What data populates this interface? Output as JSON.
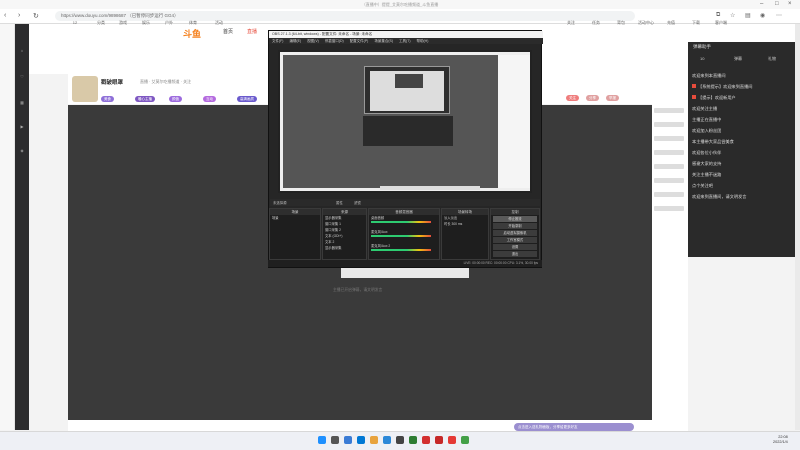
{
  "window": {
    "title": "（直播中）提提_艾莫尔吃播频道_斗鱼直播"
  },
  "browser": {
    "url": "https://www.douyu.com/9898687 （已暂停同步运行 GG4）"
  },
  "site": {
    "brand": "斗鱼",
    "nav1": "首页",
    "nav2": "直播"
  },
  "header_items": [
    {
      "label": "12"
    },
    {
      "label": "分类"
    },
    {
      "label": "游戏"
    },
    {
      "label": "娱乐"
    },
    {
      "label": "户外"
    },
    {
      "label": "体育"
    },
    {
      "label": "活动"
    }
  ],
  "header_right": [
    {
      "label": "关注"
    },
    {
      "label": "任务"
    },
    {
      "label": "背包"
    },
    {
      "label": "活动中心"
    },
    {
      "label": "充值"
    },
    {
      "label": "下载"
    },
    {
      "label": "客户端"
    }
  ],
  "streamer": {
    "name": "戳破眼罩",
    "sub": "直播 · 艾莫尔吃播频道 · 关注",
    "tags": [
      "美食",
      "暖心主播",
      "颜值",
      "互动",
      "高清画质",
      "萌宠"
    ],
    "actions": [
      "关注",
      "分享",
      "举报"
    ]
  },
  "obs": {
    "titlebar": "OBS 27.1.3 (64-bit, windows) - 配置文件: 未命名 - 场景: 未命名",
    "menu": [
      "文件(F)",
      "编辑(E)",
      "视图(V)",
      "停靠窗口(D)",
      "配置文件(P)",
      "场景集合(S)",
      "工具(T)",
      "帮助(H)"
    ],
    "source_bar": [
      "未选择源",
      "属性",
      "滤镜"
    ],
    "docks": {
      "scenes": {
        "title": "场景",
        "rows": [
          "场景"
        ]
      },
      "sources": {
        "title": "来源",
        "rows": [
          "显示器采集",
          "窗口采集 1",
          "窗口采集 2",
          "文本 (GDI+)",
          "文本 2",
          "显示器采集"
        ]
      },
      "mixer": {
        "title": "音频混音器",
        "rows": [
          "桌面音频",
          "麦克风/Aux",
          "麦克风/Aux 2"
        ]
      },
      "transitions": {
        "title": "场景转场",
        "rows": [
          "淡入淡出",
          "时长  300 ms"
        ]
      },
      "controls": {
        "title": "控制",
        "buttons": [
          "停止推流",
          "开始录制",
          "启动虚拟摄像机",
          "工作室模式",
          "设置",
          "退出"
        ]
      }
    },
    "status": "LIVE: 00:00:00  REC: 00:00:00  CPU: 3.1%, 30.00 fps"
  },
  "below_player": "主播已开启弹幕，请文明发言",
  "gift_bar": {
    "text": "点击进入送礼物面板，分享给更多好友"
  },
  "danmu_panel": {
    "title": "弹幕助手",
    "tabs": [
      "10",
      "弹幕",
      "礼物"
    ],
    "lines": [
      "欢迎来到本直播间",
      "【系统提示】欢迎来到直播间",
      "【提示】欢迎新用户",
      "欢迎关注主播",
      "主播正在直播中",
      "欢迎加入粉丝团",
      "本主播带大家品尝美食",
      "欢迎各位小伙伴",
      "感谢大家的支持",
      "关注主播不迷路",
      "点个关注吧",
      "欢迎来到直播间，请文明发言"
    ]
  },
  "clock": {
    "time": "22:08",
    "date": "2022/1/4"
  }
}
